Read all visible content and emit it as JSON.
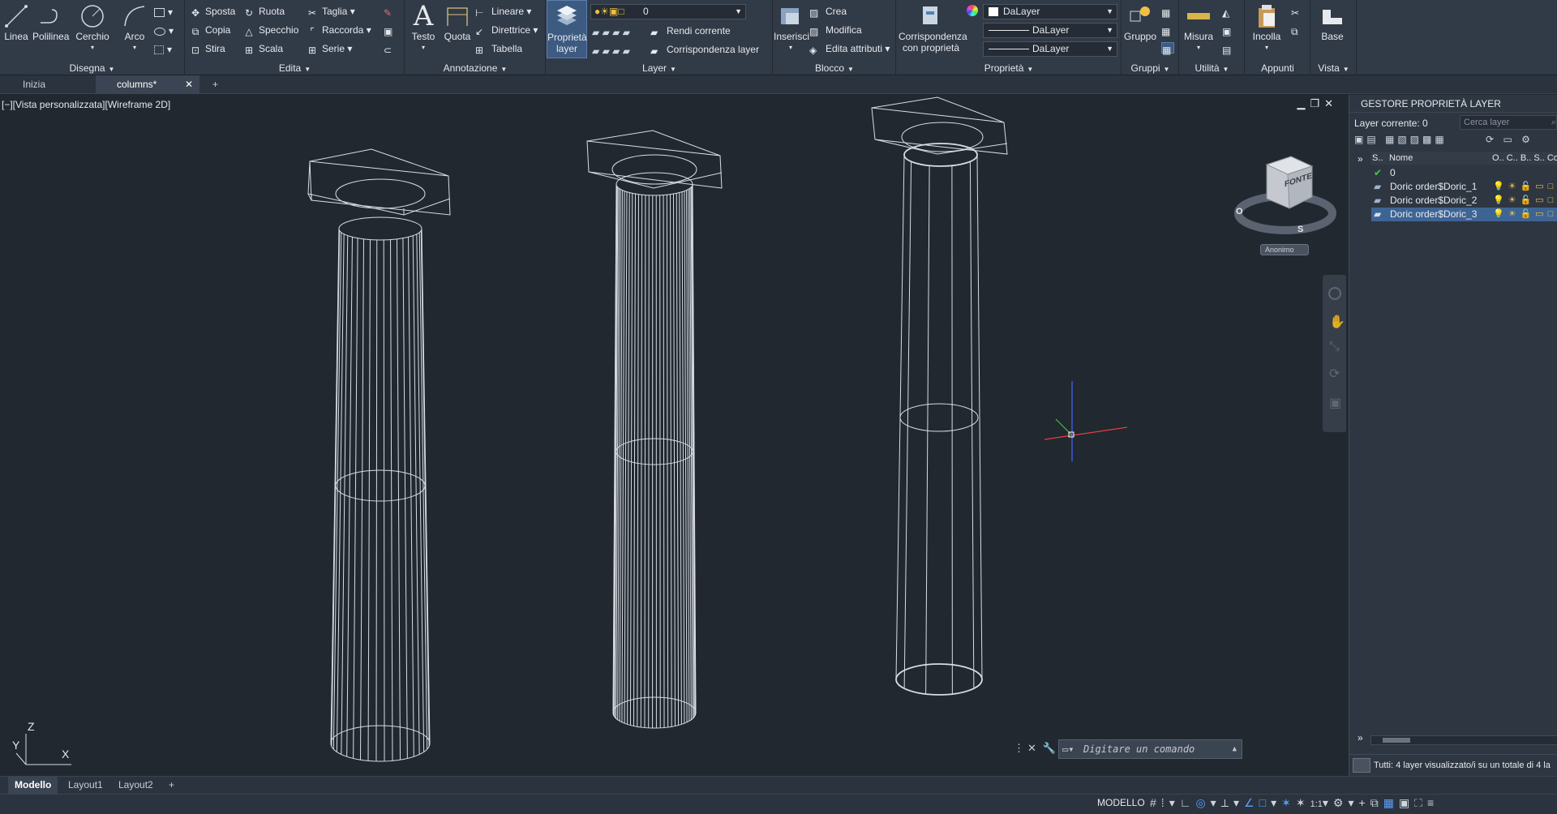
{
  "ribbon": {
    "draw": {
      "title": "Disegna",
      "line": "Linea",
      "polyline": "Polilinea",
      "circle": "Cerchio",
      "arc": "Arco"
    },
    "modify": {
      "title": "Edita",
      "move": "Sposta",
      "rotate": "Ruota",
      "trim": "Taglia",
      "copy": "Copia",
      "mirror": "Specchio",
      "fillet": "Raccorda",
      "stretch": "Stira",
      "scale": "Scala",
      "array": "Serie"
    },
    "annotation": {
      "title": "Annotazione",
      "text": "Testo",
      "dimension": "Quota",
      "linear": "Lineare",
      "leader": "Direttrice",
      "table": "Tabella"
    },
    "layer": {
      "title": "Layer",
      "properties": "Proprietà layer",
      "current_layer": "0",
      "make_current": "Rendi corrente",
      "match_layer": "Corrispondenza layer"
    },
    "block": {
      "title": "Blocco",
      "insert": "Inserisci",
      "create": "Crea",
      "edit": "Modifica",
      "edit_attributes": "Edita attributi"
    },
    "properties": {
      "title": "Proprietà",
      "match_properties": "Corrispondenza con proprietà",
      "color": "DaLayer",
      "linetype": "DaLayer",
      "lineweight": "DaLayer"
    },
    "groups": {
      "title": "Gruppi",
      "group": "Gruppo"
    },
    "utilities": {
      "title": "Utilità",
      "measure": "Misura"
    },
    "clipboard": {
      "title": "Appunti",
      "paste": "Incolla"
    },
    "view": {
      "title": "Vista",
      "base": "Base"
    }
  },
  "file_tabs": [
    {
      "label": "Inizia"
    },
    {
      "label": "columns*"
    }
  ],
  "viewport": {
    "label": "[−][Vista personalizzata][Wireframe 2D]",
    "viewcube_face": "FONTE",
    "compass_west": "O",
    "compass_south": "S",
    "wcs_label": "Anonimo",
    "ucs_z": "Z",
    "ucs_y": "Y",
    "ucs_x": "X"
  },
  "command_line": {
    "placeholder": "Digitare un comando"
  },
  "layer_panel": {
    "title": "GESTORE PROPRIETÀ LAYER",
    "current": "Layer corrente: 0",
    "search_placeholder": "Cerca layer",
    "col_status": "S..",
    "col_name": "Nome",
    "col_other": "O.. C.. B.. S.. Co",
    "layers": [
      {
        "name": "0",
        "current": true
      },
      {
        "name": "Doric order$Doric_1",
        "current": false
      },
      {
        "name": "Doric order$Doric_2",
        "current": false
      },
      {
        "name": "Doric order$Doric_3",
        "current": false
      }
    ],
    "status_text": "Tutti: 4 layer visualizzato/i su un totale di 4 la"
  },
  "layout_tabs": [
    {
      "label": "Modello"
    },
    {
      "label": "Layout1"
    },
    {
      "label": "Layout2"
    }
  ],
  "status_bar": {
    "model": "MODELLO",
    "scale": "1:1"
  },
  "colors": {
    "ribbon_bg": "#313a47",
    "viewport_bg": "#212830",
    "selected_row": "#3e6494"
  }
}
